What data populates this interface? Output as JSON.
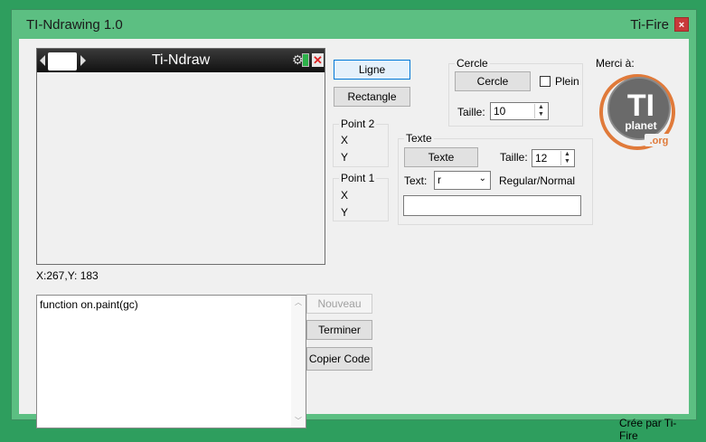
{
  "window": {
    "title": "TI-Ndrawing 1.0",
    "author": "Ti-Fire",
    "close_glyph": "×"
  },
  "calc": {
    "title": "Ti-Ndraw",
    "close_glyph": "✕",
    "gear_glyph": "⚙"
  },
  "coords": "X:267,Y: 183",
  "buttons": {
    "ligne": "Ligne",
    "rectangle": "Rectangle",
    "nouveau": "Nouveau",
    "terminer": "Terminer",
    "copier": "Copier Code"
  },
  "point2": {
    "title": "Point 2",
    "x": "X",
    "y": "Y"
  },
  "point1": {
    "title": "Point 1",
    "x": "X",
    "y": "Y"
  },
  "cercle": {
    "title": "Cercle",
    "button": "Cercle",
    "plein": "Plein",
    "taille_label": "Taille:",
    "taille_value": "10"
  },
  "texte": {
    "title": "Texte",
    "button": "Texte",
    "taille_label": "Taille:",
    "taille_value": "12",
    "text_label": "Text:",
    "select_value": "r",
    "style": "Regular/Normal",
    "input_value": ""
  },
  "merci": "Merci à:",
  "logo": {
    "ti": "TI",
    "planet": "planet",
    "org": ".org"
  },
  "code": "function on.paint(gc)",
  "credit": "Crée par Ti-Fire",
  "colors": {
    "title_bar": "#5cbf82",
    "accent": "#0078d7",
    "calc_battery": "#2db24a"
  }
}
